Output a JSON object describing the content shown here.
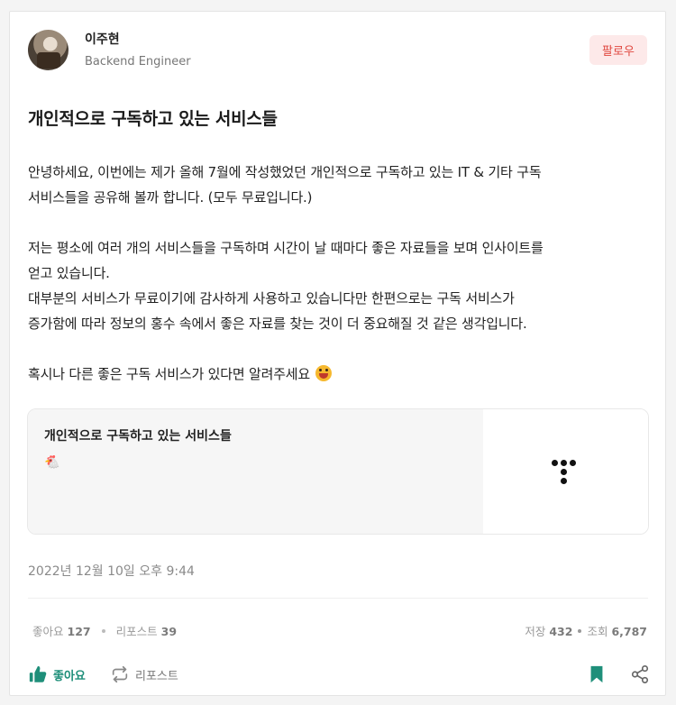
{
  "author": {
    "name": "이주현",
    "role": "Backend Engineer"
  },
  "follow_label": "팔로우",
  "post": {
    "title": "개인적으로 구독하고 있는 서비스들",
    "lines": [
      "안녕하세요, 이번에는 제가 올해 7월에 작성했었던 개인적으로 구독하고 있는 IT & 기타 구독",
      "서비스들을 공유해 볼까 합니다. (모두 무료입니다.)",
      "저는 평소에 여러 개의 서비스들을 구독하며 시간이 날 때마다 좋은 자료들을 보며 인사이트를",
      "얻고 있습니다.",
      "대부분의 서비스가 무료이기에 감사하게 사용하고 있습니다만 한편으로는 구독 서비스가",
      "증가함에 따라 정보의 홍수 속에서 좋은 자료를 찾는 것이 더 중요해질 것 같은 생각입니다.",
      "혹시나 다른 좋은 구독 서비스가 있다면 알려주세요"
    ],
    "emoji": "😜"
  },
  "link_card": {
    "title": "개인적으로 구독하고 있는 서비스들",
    "sub_icon": "🐔"
  },
  "date": "2022년 12월 10일 오후 9:44",
  "stats": {
    "likes_label": "좋아요",
    "likes": "127",
    "reposts_label": "리포스트",
    "reposts": "39",
    "saves_label": "저장",
    "saves": "432",
    "views_label": "조회",
    "views": "6,787"
  },
  "actions": {
    "like_label": "좋아요",
    "repost_label": "리포스트"
  },
  "colors": {
    "accent": "#1f8f7a",
    "follow_bg": "#fde9e9",
    "follow_text": "#e0473f"
  },
  "icons": [
    "thumbs-up-icon",
    "repost-icon",
    "bookmark-icon",
    "share-icon"
  ]
}
